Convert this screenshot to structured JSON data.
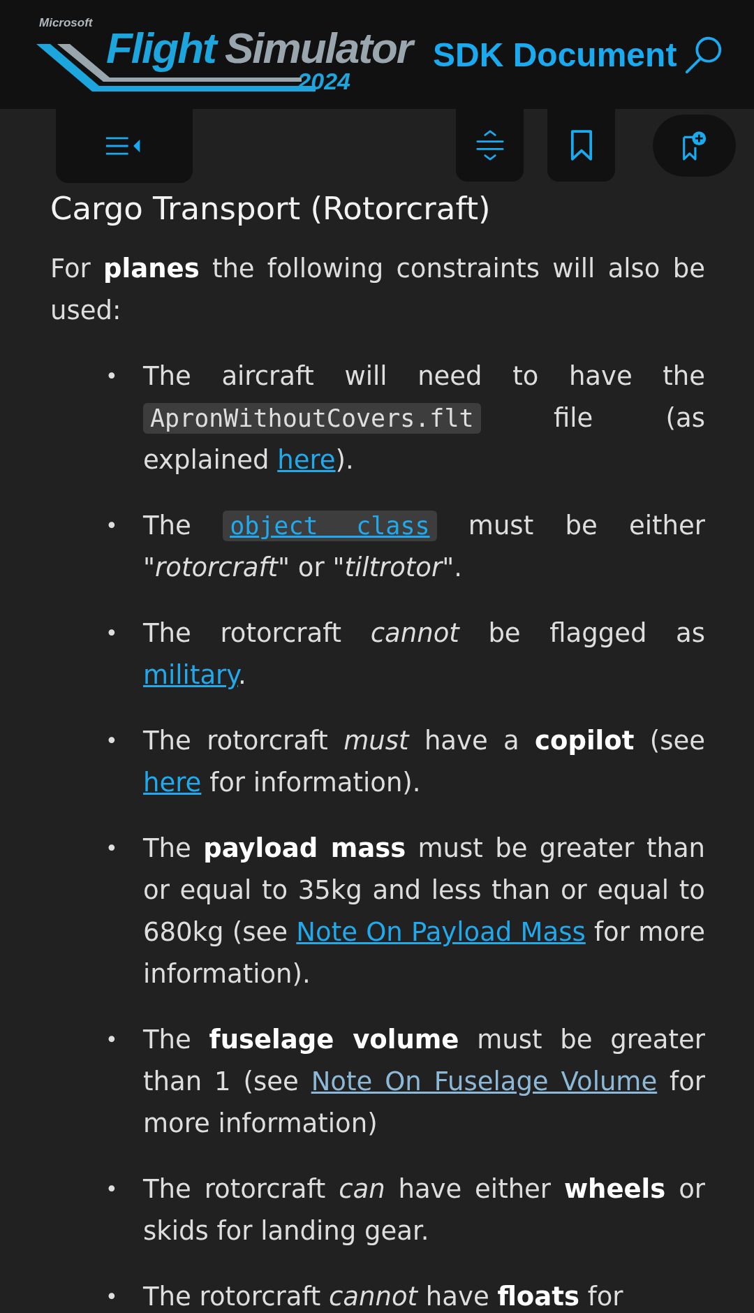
{
  "header": {
    "logo": {
      "brand": "Microsoft",
      "name_a": "Flight",
      "name_b": "Simulator",
      "year": "2024"
    },
    "title": "SDK Document"
  },
  "toolbar": {
    "buttons": [
      {
        "kind": "contents"
      },
      {
        "kind": "expand"
      },
      {
        "kind": "bookmark"
      },
      {
        "kind": "add-bookmark"
      }
    ]
  },
  "heading": "Cargo Transport (Rotorcraft)",
  "intro": "For **planes** the following constraints will also be used:",
  "items": [
    {
      "marker": "•",
      "segments": [
        {
          "kind": "text",
          "text": "The aircraft will need to have the "
        },
        {
          "kind": "code",
          "text": "ApronWithoutCovers.flt"
        },
        {
          "kind": "text",
          "text": " file (as explained "
        },
        {
          "kind": "link",
          "text": "here",
          "visited": false
        },
        {
          "kind": "text",
          "text": ")."
        }
      ]
    },
    {
      "marker": "•",
      "segments": [
        {
          "kind": "text",
          "text": "The "
        },
        {
          "kind": "code-link",
          "text": "object class"
        },
        {
          "kind": "text",
          "text": " must be either \"*rotorcraft*\" or \"*tiltrotor*\"."
        }
      ]
    },
    {
      "marker": "•",
      "segments": [
        {
          "kind": "text",
          "text": "The rotorcraft *cannot* be flagged as "
        },
        {
          "kind": "link",
          "text": "military",
          "visited": false
        },
        {
          "kind": "text",
          "text": "."
        }
      ]
    },
    {
      "marker": "•",
      "segments": [
        {
          "kind": "text",
          "text": "The rotorcraft *must* have a **copilot** (see "
        },
        {
          "kind": "link",
          "text": "here",
          "visited": false
        },
        {
          "kind": "text",
          "text": " for information)."
        }
      ]
    },
    {
      "marker": "•",
      "segments": [
        {
          "kind": "text",
          "text": "The **payload mass** must be greater than or equal to 35kg and less than or equal to 680kg (see "
        },
        {
          "kind": "link",
          "text": "Note On Payload Mass",
          "visited": false
        },
        {
          "kind": "text",
          "text": " for more information)."
        }
      ]
    },
    {
      "marker": "•",
      "segments": [
        {
          "kind": "text",
          "text": "The **fuselage volume** must be greater than 1 (see "
        },
        {
          "kind": "link",
          "text": "Note On Fuselage Volume",
          "visited": true
        },
        {
          "kind": "text",
          "text": " for more information)"
        }
      ]
    },
    {
      "marker": "•",
      "segments": [
        {
          "kind": "text",
          "text": "The rotorcraft *can* have either **wheels** or skids for landing gear."
        }
      ]
    },
    {
      "marker": "•",
      "segments": [
        {
          "kind": "text",
          "text": "The rotorcraft *cannot* have **floats** for"
        }
      ]
    }
  ]
}
